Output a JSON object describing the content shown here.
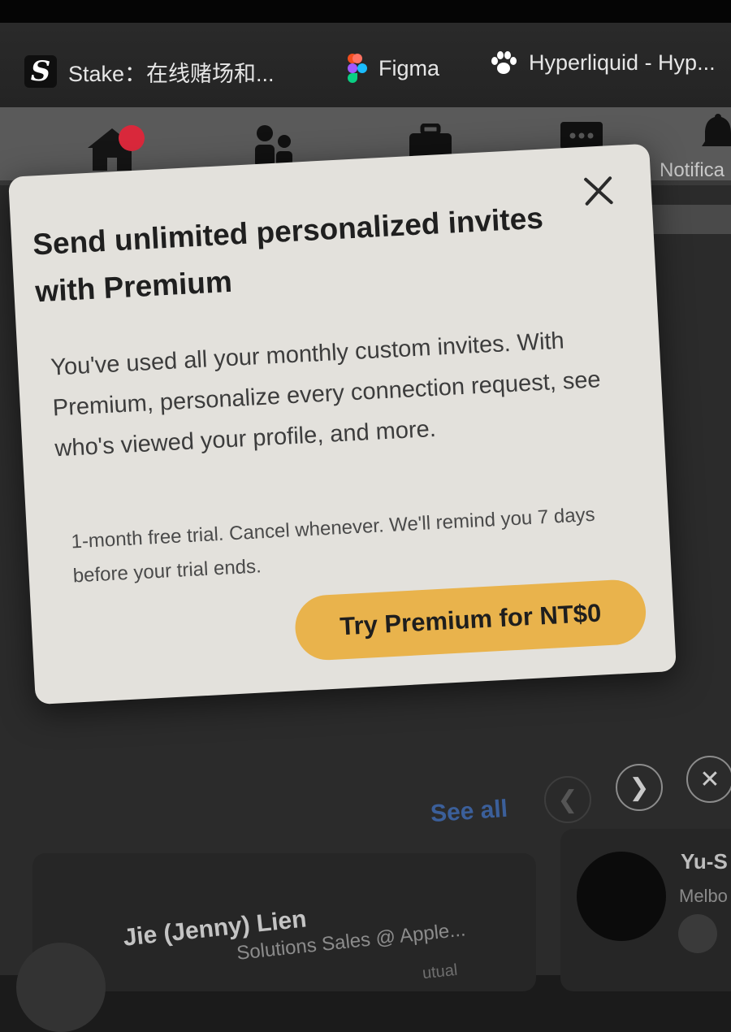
{
  "bookmarks": [
    {
      "title": "Stake：在线赌场和...",
      "icon": "stake-logo-icon"
    },
    {
      "title": "Figma",
      "icon": "figma-logo-icon"
    },
    {
      "title": "Hyperliquid - Hyp...",
      "icon": "paw-icon"
    }
  ],
  "nav": {
    "items": [
      "home-icon",
      "network-icon",
      "jobs-icon",
      "messaging-icon",
      "notifications-icon"
    ],
    "notifications_label": "Notifica"
  },
  "modal": {
    "title": "Send unlimited personalized invites with Premium",
    "body": "You've used all your monthly custom invites. With Premium, personalize every connection request, see who's viewed your profile, and more.",
    "note": "1-month free trial. Cancel whenever. We'll remind you 7 days before your trial ends.",
    "cta_label": "Try Premium for NT$0",
    "close_icon": "close-icon"
  },
  "background": {
    "see_all": "See all",
    "prev_glyph": "❮",
    "next_glyph": "❯",
    "dismiss_glyph": "✕",
    "person": {
      "name": "Jie (Jenny) Lien",
      "role": "Solutions Sales @ Apple...",
      "extra": "utual"
    },
    "person2": {
      "name": "Yu-S",
      "location": "Melbo"
    }
  },
  "colors": {
    "cta": "#e9b34c",
    "modal_bg": "#e3e1dc",
    "link": "#3b5f9a",
    "notification_red": "#d9283b"
  }
}
